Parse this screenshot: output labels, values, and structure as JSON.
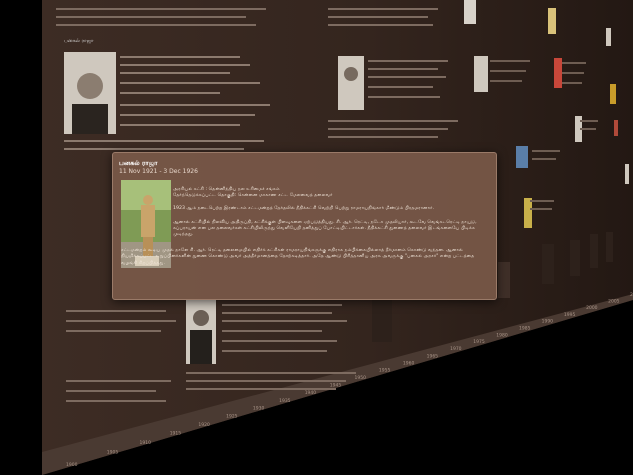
{
  "timeline": {
    "card_left_title": "பனகல் ராஜா",
    "years": [
      "1900",
      "1905",
      "1910",
      "1915",
      "1920",
      "1925",
      "1930",
      "1935",
      "1940",
      "1945",
      "1950",
      "1955",
      "1960",
      "1965",
      "1970",
      "1975",
      "1980",
      "1985",
      "1990",
      "1995",
      "2000",
      "2005",
      "2010"
    ]
  },
  "popup": {
    "title": "பனகல் ராஜா",
    "dates": "11 Nov 1921 - 3 Dec 1926",
    "paragraphs": [
      "அரசியல் கட்சி : தென்னிந்திய நல உரிமைச் சங்கம்\nதேர்ந்தெடுக்கப்பட்ட தொகுதி: சென்னை மாகாண சட்ட மேலவைத் தலைவர்",
      "1923 ஆம் நடைபெற்ற இரண்டாம் சட்டமன்றத் தேர்தலில் நீதிக்கட்சி வெற்றி பெற்று ராமராயநிங்கார் மீண்டும் பிரதமரானார்.",
      "ஆனால் கட்சியில் நிலவிய அதிருப்தி, கட்சிக்குள் பிளவுகளை ஏற்படுத்தியது. சி. ஆர். ரெட்டி, நடேச முதலியார், கூடவே வெங்கடரெட்டி நாயுடு, சுப்பராயன் என பல தலைவர்கள் கட்சியிலிருந்து வெளியேறி தனித்துப் போட்டியிட்டார்கள். நீதிக்கட்சி துணைத் தலைவர் இடங்களையே பிடிக்க முடிந்தது."
    ],
    "wide_paragraph": "சட்டமன்றம் கூடிய முதல் நாளே சி. ஆர். ரெட்டி தலைமையில் எதிர்க் கட்சிகள் ராமராயநிங்கருக்கு எதிராக நம்பிக்கையில்லாத் தீர்மானம் கொண்டு வந்தன. ஆனால் நியமிக்கப்பட்ட உறுப்பினர்களின் துணை கொண்டு அவர் அத்தீர்மானத்தை தோற்கடித்தார். அதே ஆண்டு பிரித்தானிய அரசு அவருக்கு \"பனகல் அரசர்\" என்ற பட்டத்தை வழங்கி சிறப்பித்தது."
  },
  "colors": {
    "wall": "#3a2a22",
    "popup_bg": "#785848",
    "text": "#f1e6dc",
    "ground": "#000000"
  }
}
